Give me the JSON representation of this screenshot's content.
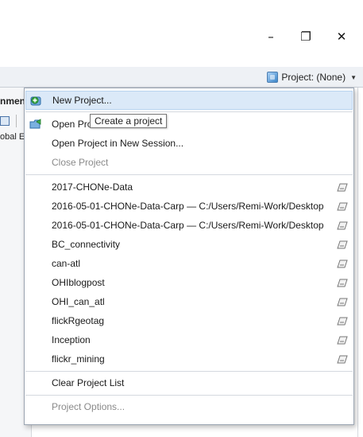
{
  "window": {
    "buttons": {
      "minimize": "–",
      "maximize": "❐",
      "close": "✕"
    }
  },
  "toolbar": {
    "project_label": "Project: (None)"
  },
  "left_pane": {
    "tab_label": "nmen",
    "row_text": "obal E"
  },
  "menu": {
    "top_items": [
      {
        "label": "New Project...",
        "icon": "new-project-icon",
        "highlighted": true
      },
      {
        "label": "Open Pro",
        "icon": "open-project-icon"
      },
      {
        "label": "Open Project in New Session...",
        "icon": ""
      },
      {
        "label": "Close Project",
        "icon": "",
        "disabled": true
      }
    ],
    "recent_projects": [
      "2017-CHONe-Data",
      "2016-05-01-CHONe-Data-Carp — C:/Users/Remi-Work/Desktop",
      "2016-05-01-CHONe-Data-Carp — C:/Users/Remi-Work/Desktop",
      "BC_connectivity",
      "can-atl",
      "OHIblogpost",
      "OHI_can_atl",
      "flickRgeotag",
      "Inception",
      "flickr_mining"
    ],
    "clear_label": "Clear Project List",
    "options_label": "Project Options..."
  },
  "tooltip": {
    "text": "Create a project"
  },
  "colors": {
    "highlight": "#dbe9f8",
    "toolbar": "#eef1f5",
    "disabled_text": "#8a8a8a"
  }
}
